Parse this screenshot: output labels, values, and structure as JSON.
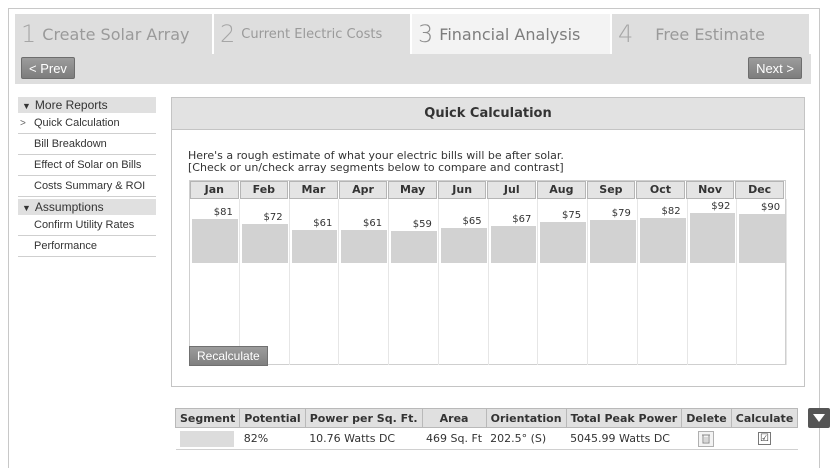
{
  "steps": [
    {
      "num": "1",
      "label": "Create Solar Array"
    },
    {
      "num": "2",
      "label": "Current Electric Costs"
    },
    {
      "num": "3",
      "label": "Financial Analysis"
    },
    {
      "num": "4",
      "label": "Free Estimate"
    }
  ],
  "nav": {
    "prev": "< Prev",
    "next": "Next >"
  },
  "sidebar": {
    "more_reports": "More Reports",
    "reports": [
      "Quick Calculation",
      "Bill Breakdown",
      "Effect of Solar on Bills",
      "Costs Summary & ROI"
    ],
    "assumptions": "Assumptions",
    "assumption_items": [
      "Confirm Utility Rates",
      "Performance"
    ]
  },
  "panel": {
    "title": "Quick Calculation",
    "intro_line1": "Here's a rough estimate of what your electric bills will be after solar.",
    "intro_line2": "[Check or un/check array segments below to compare and contrast]",
    "recalculate": "Recalculate"
  },
  "chart_data": {
    "type": "bar",
    "categories": [
      "Jan",
      "Feb",
      "Mar",
      "Apr",
      "May",
      "Jun",
      "Jul",
      "Aug",
      "Sep",
      "Oct",
      "Nov",
      "Dec"
    ],
    "values": [
      81,
      72,
      61,
      61,
      59,
      65,
      67,
      75,
      79,
      82,
      92,
      90
    ],
    "value_labels": [
      "$81",
      "$72",
      "$61",
      "$61",
      "$59",
      "$65",
      "$67",
      "$75",
      "$79",
      "$82",
      "$92",
      "$90"
    ],
    "ylim": [
      0,
      110
    ],
    "bar_color": "#d2d2d2"
  },
  "segments": {
    "headers": [
      "Segment",
      "Potential",
      "Power per Sq. Ft.",
      "Area",
      "Orientation",
      "Total Peak Power",
      "Delete",
      "Calculate"
    ],
    "rows": [
      {
        "potential": "82%",
        "power_per_sqft": "10.76 Watts DC",
        "area": "469 Sq. Ft",
        "orientation": "202.5° (S)",
        "total_peak_power": "5045.99 Watts DC",
        "calculate": "☑"
      }
    ]
  }
}
